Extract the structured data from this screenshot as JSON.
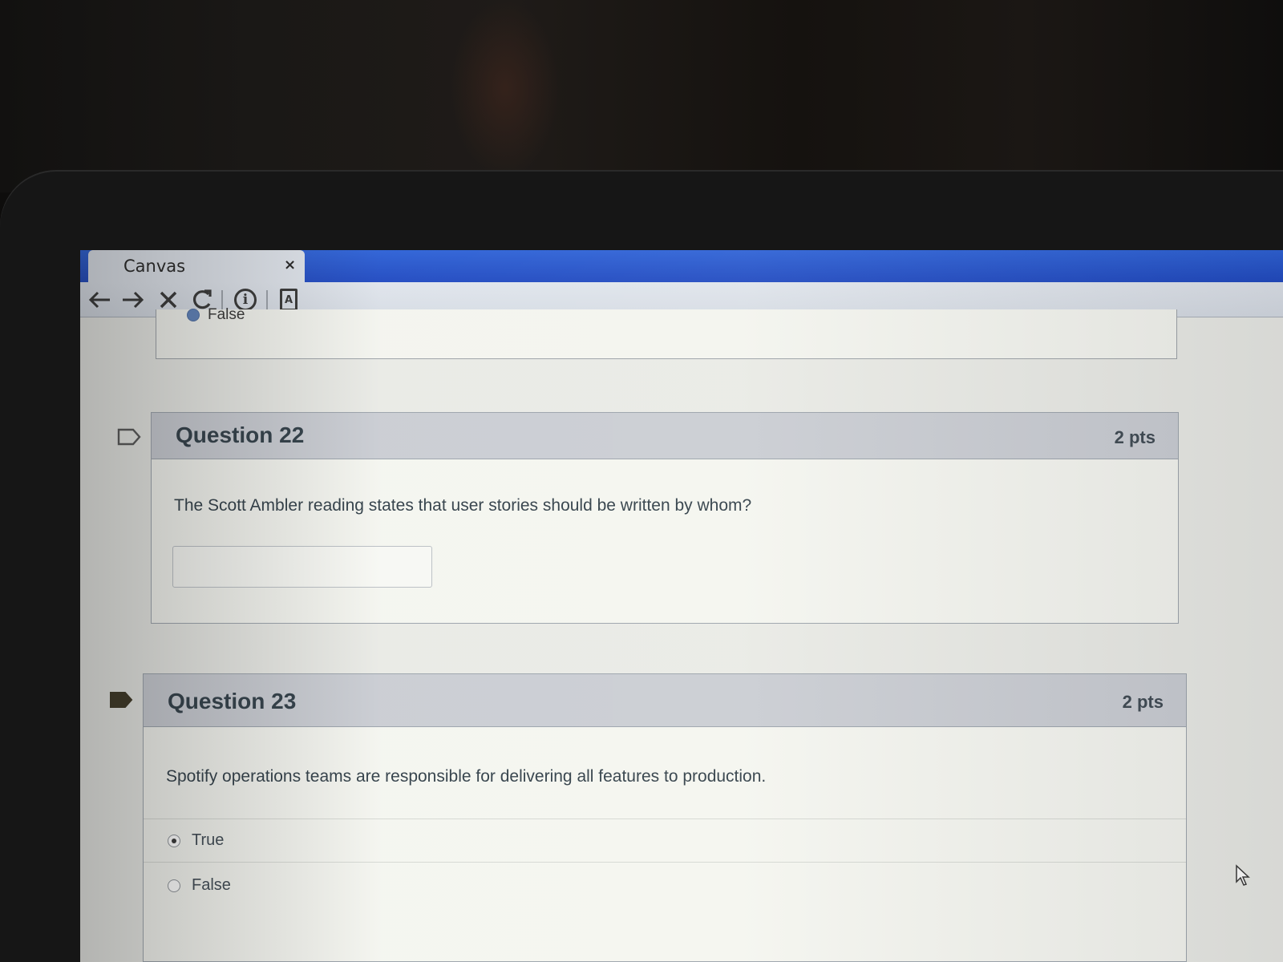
{
  "browser": {
    "tab_title": "Canvas",
    "tab_close": "×",
    "toolbar_icons": [
      "back-arrow-icon",
      "forward-arrow-icon",
      "stop-icon",
      "reload-icon",
      "info-icon",
      "page-icon"
    ]
  },
  "previous_question": {
    "answer_label": "False"
  },
  "questions": [
    {
      "title": "Question 22",
      "points": "2 pts",
      "flagged": false,
      "text": "The Scott Ambler reading states that user stories should be written by whom?",
      "answer_value": "",
      "type": "short-answer"
    },
    {
      "title": "Question 23",
      "points": "2 pts",
      "flagged": true,
      "text": "Spotify operations teams are responsible for delivering all features to production.",
      "type": "true-false",
      "options": [
        {
          "label": "True",
          "selected": true
        },
        {
          "label": "False",
          "selected": false
        }
      ]
    }
  ],
  "colors": {
    "tab_strip": "#1c46c0",
    "question_header": "#c9ccd3",
    "flag_filled": "#3a3320",
    "text": "#2d3b45"
  }
}
